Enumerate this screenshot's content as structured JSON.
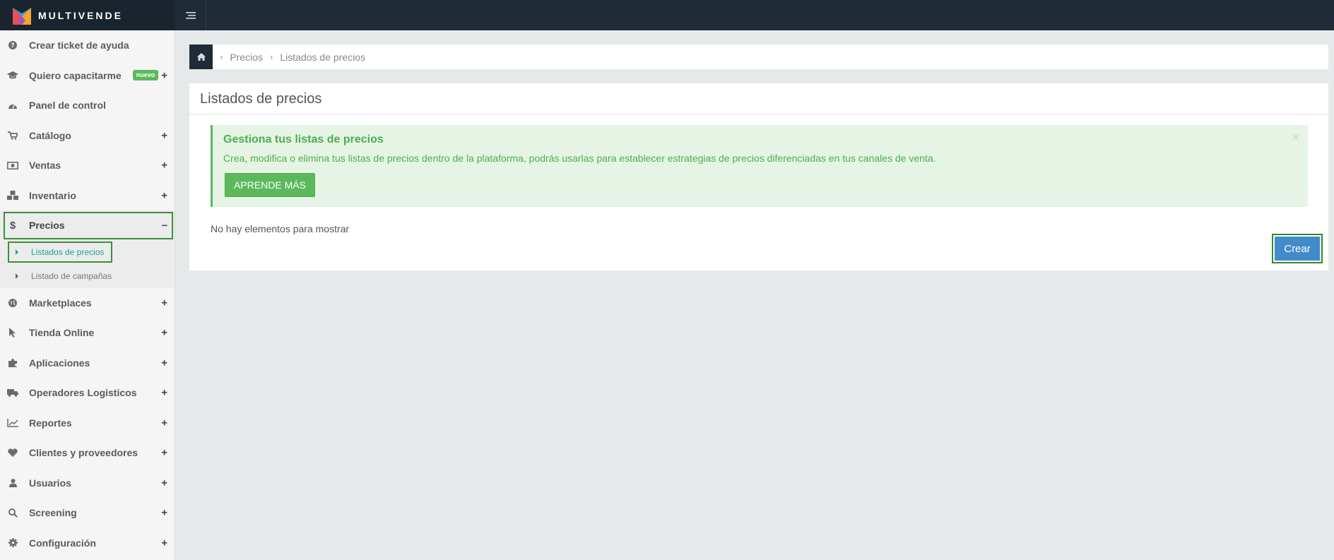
{
  "brand": {
    "name": "MULTIVENDE"
  },
  "sidebar": {
    "items": [
      {
        "label": "Crear ticket de ayuda",
        "icon": "question-icon"
      },
      {
        "label": "Quiero capacitarme",
        "icon": "graduation-cap-icon",
        "badge": "nuevo"
      },
      {
        "label": "Panel de control",
        "icon": "dashboard-icon"
      },
      {
        "label": "Catálogo",
        "icon": "cart-icon"
      },
      {
        "label": "Ventas",
        "icon": "money-icon"
      },
      {
        "label": "Inventario",
        "icon": "cubes-icon"
      },
      {
        "label": "Precios",
        "icon": "dollar-icon",
        "toggle": "–"
      },
      {
        "label": "Marketplaces",
        "icon": "globe-icon"
      },
      {
        "label": "Tienda Online",
        "icon": "pointer-icon"
      },
      {
        "label": "Aplicaciones",
        "icon": "puzzle-icon"
      },
      {
        "label": "Operadores Logisticos",
        "icon": "truck-icon"
      },
      {
        "label": "Reportes",
        "icon": "chart-icon"
      },
      {
        "label": "Clientes y proveedores",
        "icon": "heart-icon"
      },
      {
        "label": "Usuarios",
        "icon": "user-icon"
      },
      {
        "label": "Screening",
        "icon": "search-icon"
      },
      {
        "label": "Configuración",
        "icon": "gear-icon"
      }
    ],
    "precios_subitems": [
      {
        "label": "Listados de precios"
      },
      {
        "label": "Listado de campañas"
      }
    ],
    "plus": "+"
  },
  "breadcrumb": {
    "items": [
      "Precios",
      "Listados de precios"
    ],
    "separator": "›"
  },
  "panel": {
    "title": "Listados de precios",
    "alert": {
      "title": "Gestiona tus listas de precios",
      "text": "Crea, modifica o elimina tus listas de precios dentro de la plataforma, podrás usarlas para establecer estrategias de precios diferenciadas en tus canales de venta.",
      "button": "APRENDE MÁS",
      "close": "×"
    },
    "empty_text": "No hay elementos para mostrar",
    "create_button": "Crear"
  },
  "colors": {
    "topbar": "#1f2b36",
    "accent_green": "#5cb85c",
    "primary_blue": "#428bca",
    "active_teal": "#1aa292"
  }
}
